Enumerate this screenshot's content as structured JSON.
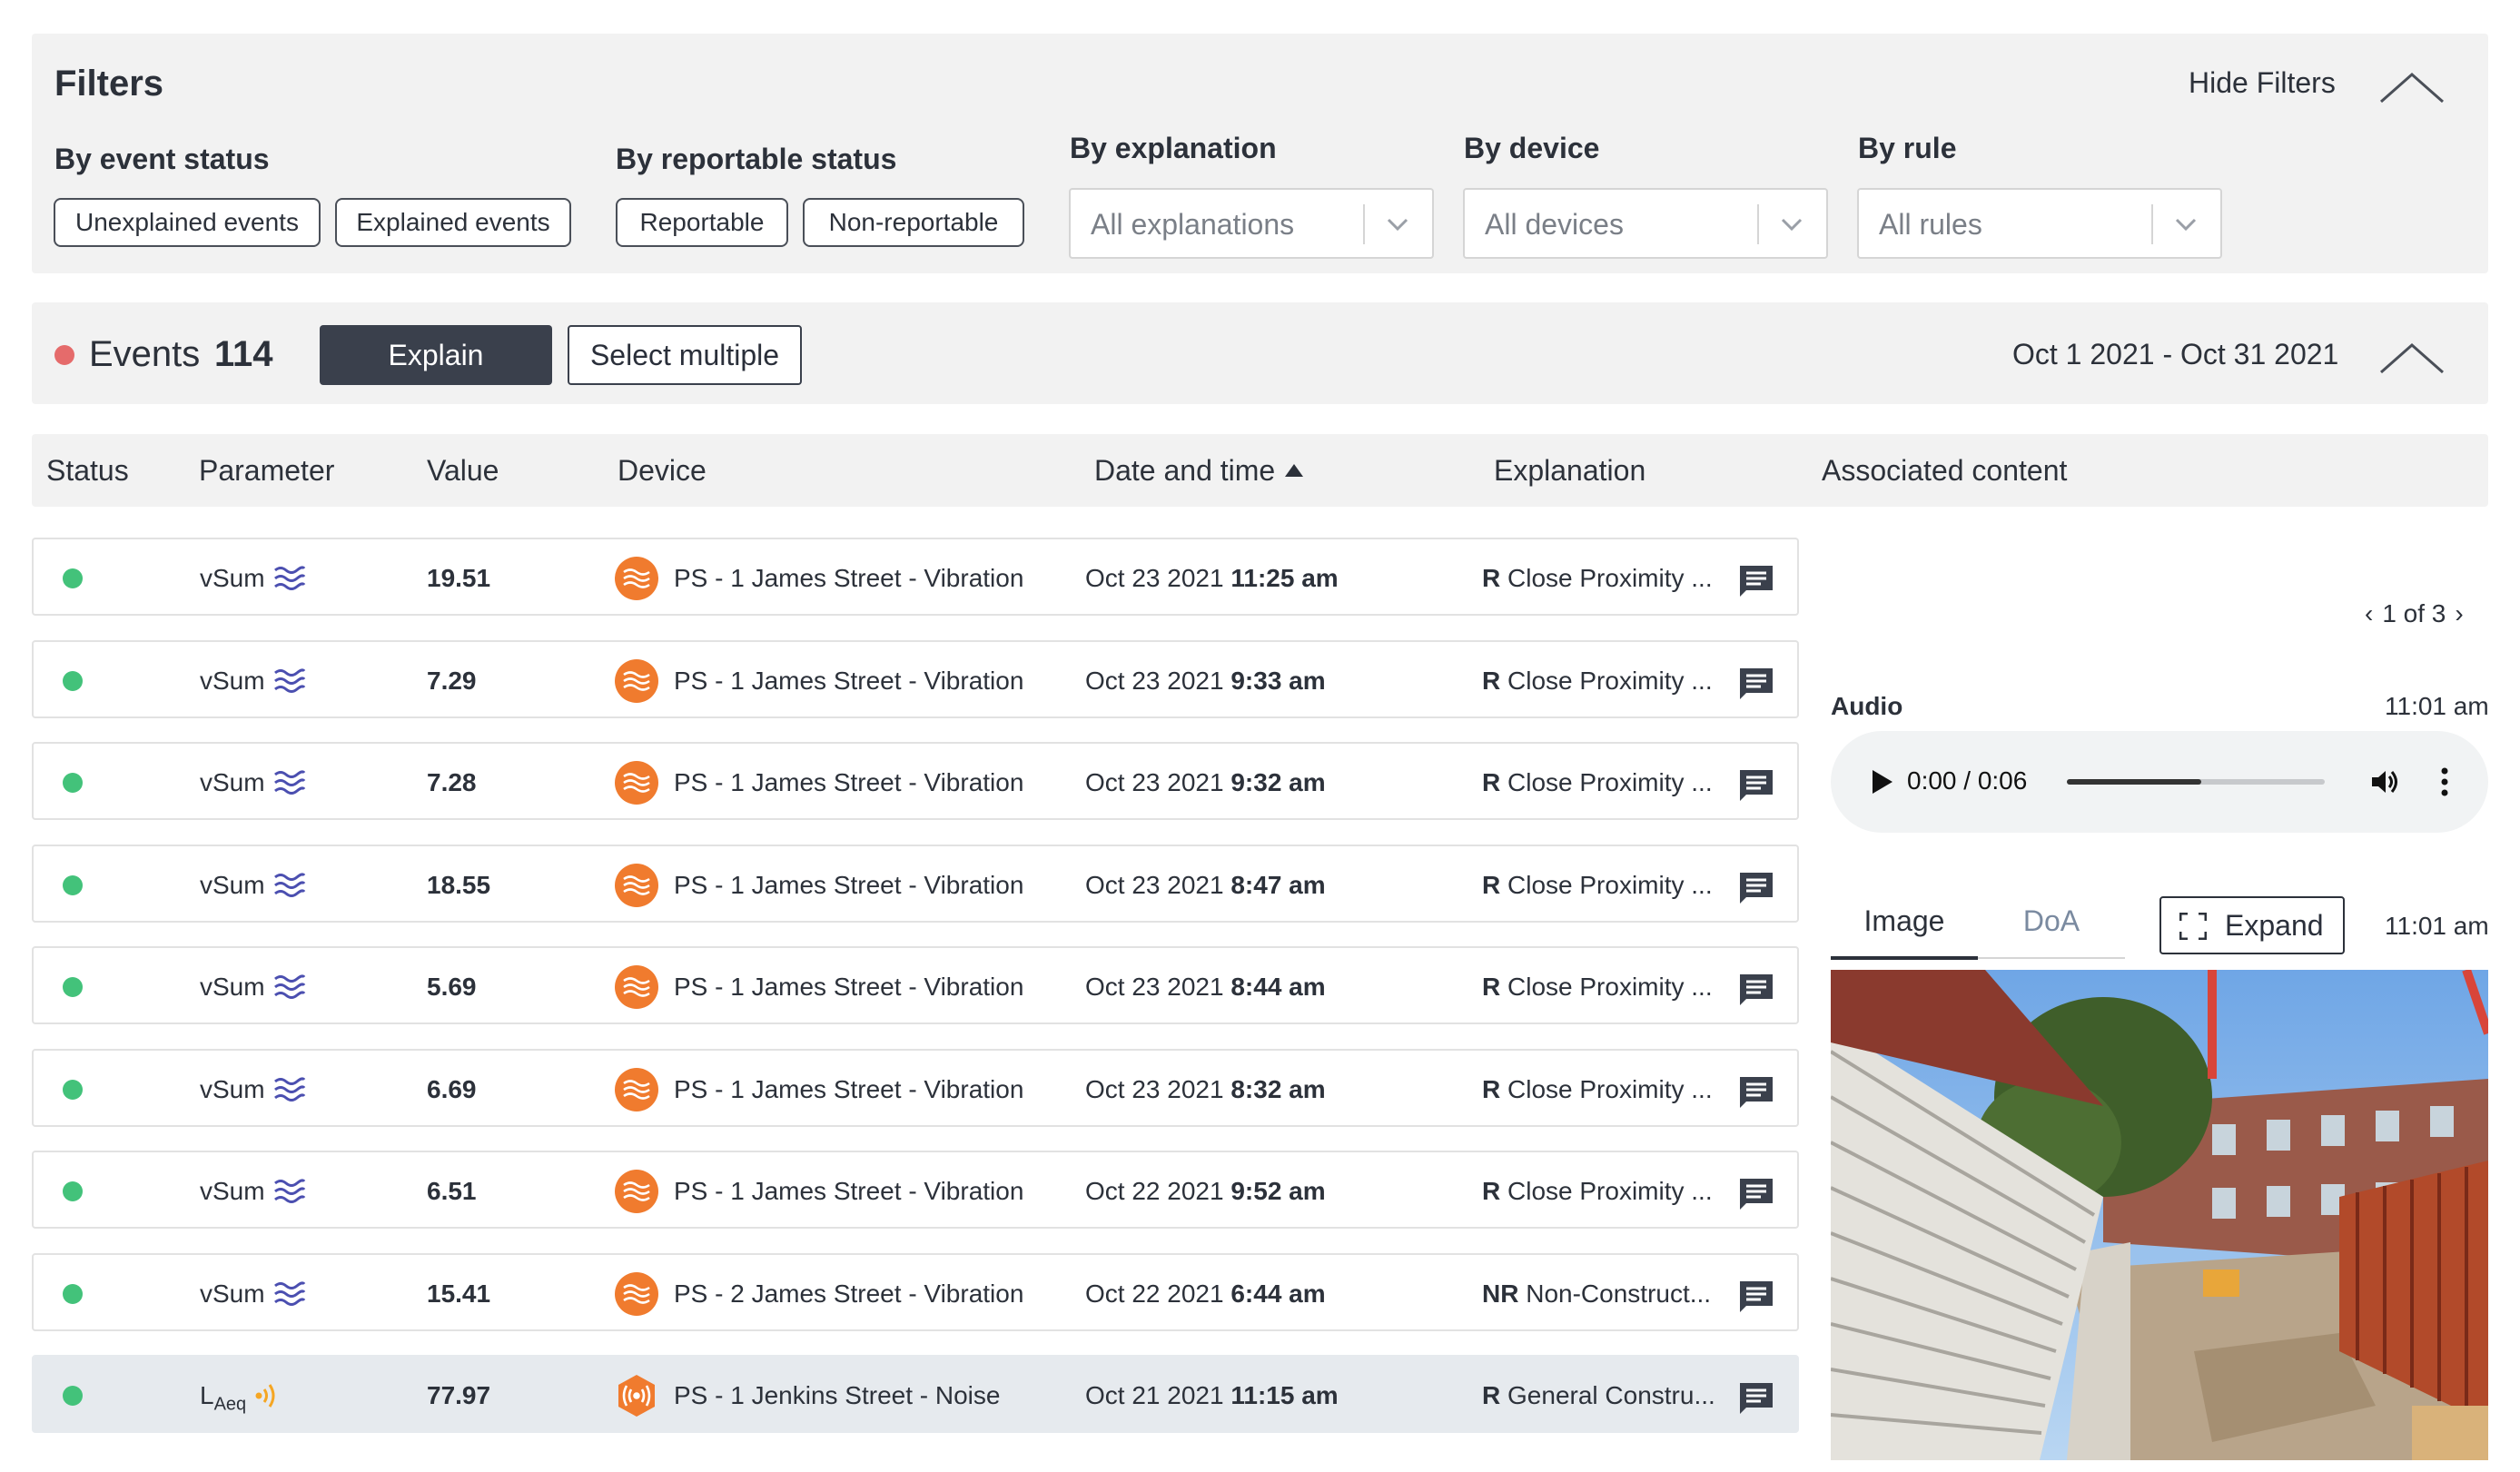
{
  "filters": {
    "title": "Filters",
    "hide_label": "Hide Filters",
    "event_status": {
      "label": "By event status",
      "options": [
        "Unexplained events",
        "Explained events"
      ]
    },
    "reportable_status": {
      "label": "By reportable status",
      "options": [
        "Reportable",
        "Non-reportable"
      ]
    },
    "explanation": {
      "label": "By explanation",
      "value": "All explanations"
    },
    "device": {
      "label": "By device",
      "value": "All devices"
    },
    "rule": {
      "label": "By rule",
      "value": "All rules"
    }
  },
  "events": {
    "title": "Events",
    "count": "114",
    "explain_label": "Explain",
    "select_multiple_label": "Select multiple",
    "date_range": "Oct 1 2021 - Oct 31 2021"
  },
  "table": {
    "columns": [
      "Status",
      "Parameter",
      "Value",
      "Device",
      "Date and time",
      "Explanation",
      "Associated content"
    ],
    "rows": [
      {
        "param": "vSum",
        "param_icon": "wave-icon",
        "value": "19.51",
        "device": "PS - 1 James Street - Vibration",
        "date": "Oct 23 2021",
        "time": "11:25 am",
        "exp_code": "R",
        "exp_text": "Close Proximity ...",
        "selected": false
      },
      {
        "param": "vSum",
        "param_icon": "wave-icon",
        "value": "7.29",
        "device": "PS - 1 James Street - Vibration",
        "date": "Oct 23 2021",
        "time": "9:33 am",
        "exp_code": "R",
        "exp_text": "Close Proximity ...",
        "selected": false
      },
      {
        "param": "vSum",
        "param_icon": "wave-icon",
        "value": "7.28",
        "device": "PS - 1 James Street - Vibration",
        "date": "Oct 23 2021",
        "time": "9:32 am",
        "exp_code": "R",
        "exp_text": "Close Proximity ...",
        "selected": false
      },
      {
        "param": "vSum",
        "param_icon": "wave-icon",
        "value": "18.55",
        "device": "PS - 1 James Street - Vibration",
        "date": "Oct 23 2021",
        "time": "8:47 am",
        "exp_code": "R",
        "exp_text": "Close Proximity ...",
        "selected": false
      },
      {
        "param": "vSum",
        "param_icon": "wave-icon",
        "value": "5.69",
        "device": "PS - 1 James Street - Vibration",
        "date": "Oct 23 2021",
        "time": "8:44 am",
        "exp_code": "R",
        "exp_text": "Close Proximity ...",
        "selected": false
      },
      {
        "param": "vSum",
        "param_icon": "wave-icon",
        "value": "6.69",
        "device": "PS - 1 James Street - Vibration",
        "date": "Oct 23 2021",
        "time": "8:32 am",
        "exp_code": "R",
        "exp_text": "Close Proximity ...",
        "selected": false
      },
      {
        "param": "vSum",
        "param_icon": "wave-icon",
        "value": "6.51",
        "device": "PS - 1 James Street - Vibration",
        "date": "Oct 22 2021",
        "time": "9:52 am",
        "exp_code": "R",
        "exp_text": "Close Proximity ...",
        "selected": false
      },
      {
        "param": "vSum",
        "param_icon": "wave-icon",
        "value": "15.41",
        "device": "PS - 2 James Street - Vibration",
        "date": "Oct 22 2021",
        "time": "6:44 am",
        "exp_code": "NR",
        "exp_text": "Non-Construct...",
        "selected": false
      },
      {
        "param": "L",
        "param_sub": "Aeq",
        "param_icon": "sound-icon",
        "value": "77.97",
        "device": "PS - 1 Jenkins Street - Noise",
        "date": "Oct 21 2021",
        "time": "11:15 am",
        "exp_code": "R",
        "exp_text": "General Constru...",
        "selected": true
      }
    ]
  },
  "associated": {
    "pager": "1 of 3",
    "audio": {
      "label": "Audio",
      "time": "11:01 am",
      "playback": "0:00 / 0:06",
      "progress": 0.52
    },
    "tabs": [
      "Image",
      "DoA"
    ],
    "expand_label": "Expand",
    "image_time": "11:01 am"
  },
  "colors": {
    "status_ok": "#43c27a",
    "events_dot": "#e56b6b",
    "device_orange": "#f07b2e",
    "vibration_icon": "#4b4fb0",
    "noise_icon": "#f5a623"
  }
}
